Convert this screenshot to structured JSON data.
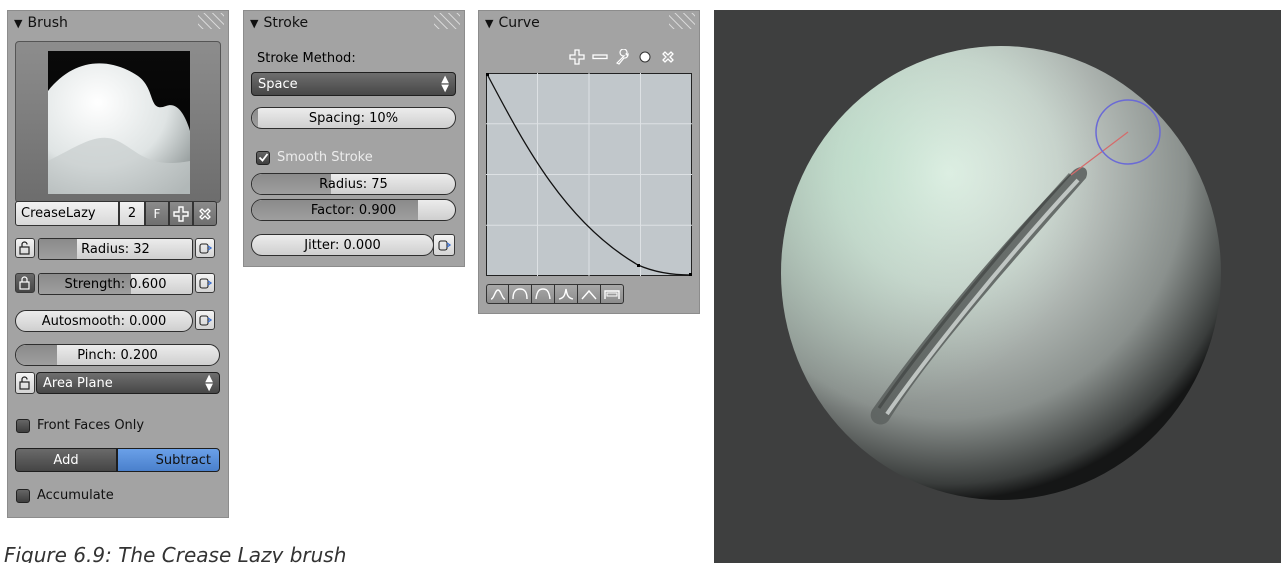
{
  "brush": {
    "title": "Brush",
    "name_field": "CreaseLazy",
    "users": "2",
    "fake_user": "F",
    "radius": "Radius: 32",
    "radius_value": 0.25,
    "strength": "Strength: 0.600",
    "strength_value": 0.6,
    "autosmooth": "Autosmooth: 0.000",
    "pinch": "Pinch: 0.200",
    "pinch_value": 0.2,
    "sculpt_plane": "Area Plane",
    "front_faces": "Front Faces Only",
    "add": "Add",
    "subtract": "Subtract",
    "accumulate": "Accumulate"
  },
  "stroke": {
    "title": "Stroke",
    "method_label": "Stroke Method:",
    "method_value": "Space",
    "spacing": "Spacing: 10%",
    "smooth_stroke": "Smooth Stroke",
    "smooth_checked": true,
    "radius": "Radius: 75",
    "radius_value": 0.39,
    "factor": "Factor: 0.900",
    "factor_value": 0.9,
    "jitter": "Jitter: 0.000"
  },
  "curve": {
    "title": "Curve"
  },
  "caption": "Figure 6.9: The Crease Lazy brush",
  "colors": {
    "panel_bg": "#a3a3a3",
    "selected_blue": "#5b8fd6",
    "viewport_bg": "#3d3d3d",
    "brush_circle": "#6a6ad6"
  }
}
